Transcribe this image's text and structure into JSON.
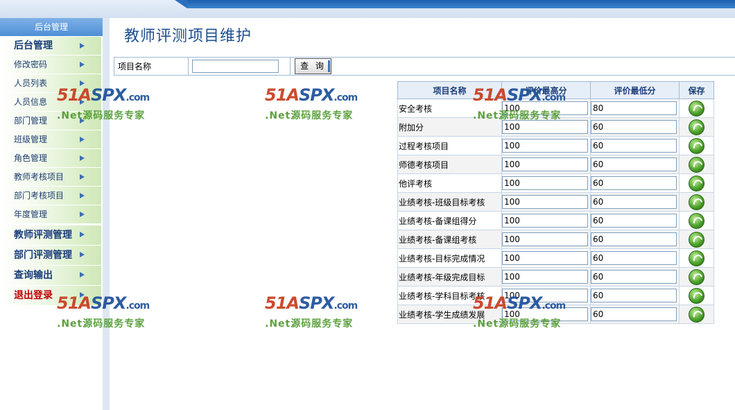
{
  "sidebar": {
    "header": "后台管理",
    "items": [
      {
        "label": "后台管理",
        "big": true
      },
      {
        "label": "修改密码"
      },
      {
        "label": "人员列表"
      },
      {
        "label": "人员信息"
      },
      {
        "label": "部门管理"
      },
      {
        "label": "班级管理"
      },
      {
        "label": "角色管理"
      },
      {
        "label": "教师考核项目"
      },
      {
        "label": "部门考核项目"
      },
      {
        "label": "年度管理"
      },
      {
        "label": "教师评测管理",
        "big": true
      },
      {
        "label": "部门评测管理",
        "big": true
      },
      {
        "label": "查询输出",
        "big": true
      },
      {
        "label": "退出登录",
        "big": true,
        "red": true
      }
    ]
  },
  "page": {
    "title": "教师评测项目维护"
  },
  "search": {
    "label": "项目名称",
    "value": "",
    "button": "查 询"
  },
  "table": {
    "headers": {
      "name": "项目名称",
      "max": "评价最高分",
      "min": "评价最低分",
      "save": "保存"
    },
    "rows": [
      {
        "name": "安全考核",
        "max": "100",
        "min": "80"
      },
      {
        "name": "附加分",
        "max": "100",
        "min": "60"
      },
      {
        "name": "过程考核项目",
        "max": "100",
        "min": "60"
      },
      {
        "name": "师德考核项目",
        "max": "100",
        "min": "60"
      },
      {
        "name": "他评考核",
        "max": "100",
        "min": "60"
      },
      {
        "name": "业绩考核-班级目标考核",
        "max": "100",
        "min": "60"
      },
      {
        "name": "业绩考核-备课组得分",
        "max": "100",
        "min": "60"
      },
      {
        "name": "业绩考核-备课组考核",
        "max": "100",
        "min": "60"
      },
      {
        "name": "业绩考核-目标完成情况",
        "max": "100",
        "min": "60"
      },
      {
        "name": "业绩考核-年级完成目标",
        "max": "100",
        "min": "60"
      },
      {
        "name": "业绩考核-学科目标考核",
        "max": "100",
        "min": "60"
      },
      {
        "name": "业绩考核-学生成绩发展",
        "max": "100",
        "min": "60"
      }
    ]
  },
  "watermark": {
    "logo_num": "51",
    "logo_a": "A",
    "logo_spx": "SPX",
    "logo_dom": ".com",
    "sub": ".Net源码服务专家"
  }
}
